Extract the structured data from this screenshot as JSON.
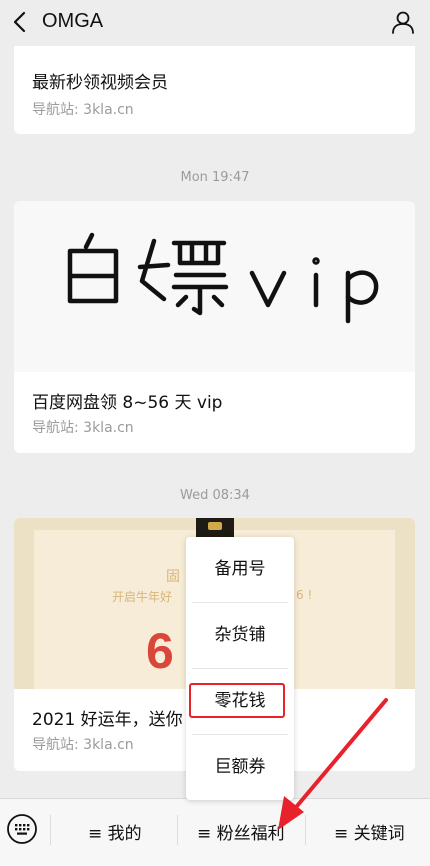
{
  "header": {
    "title": "OMGA"
  },
  "messages": [
    {
      "title": "最新秒领视频会员",
      "subtitle": "导航站: 3kla.cn"
    },
    {
      "time": "Mon 19:47",
      "banner_text": "白 嫖 vip",
      "title": "百度网盘领 8~56 天 vip",
      "subtitle": "导航站: 3kla.cn"
    },
    {
      "time": "Wed 08:34",
      "banner_line1": "固",
      "banner_line2": "开启牛年好",
      "banner_line2_end": "6 !",
      "banner_big": "6",
      "title": "2021 好运年，送你",
      "subtitle": "导航站: 3kla.cn"
    }
  ],
  "menu": {
    "items": [
      {
        "label": "备用号"
      },
      {
        "label": "杂货铺"
      },
      {
        "label": "零花钱"
      },
      {
        "label": "巨额券"
      }
    ]
  },
  "tabs": [
    {
      "label": "≡ 我的"
    },
    {
      "label": "≡ 粉丝福利"
    },
    {
      "label": "≡ 关键词"
    }
  ],
  "colors": {
    "highlight": "#e8222b",
    "arrow": "#e8222b",
    "banner_red": "#d9473a"
  }
}
